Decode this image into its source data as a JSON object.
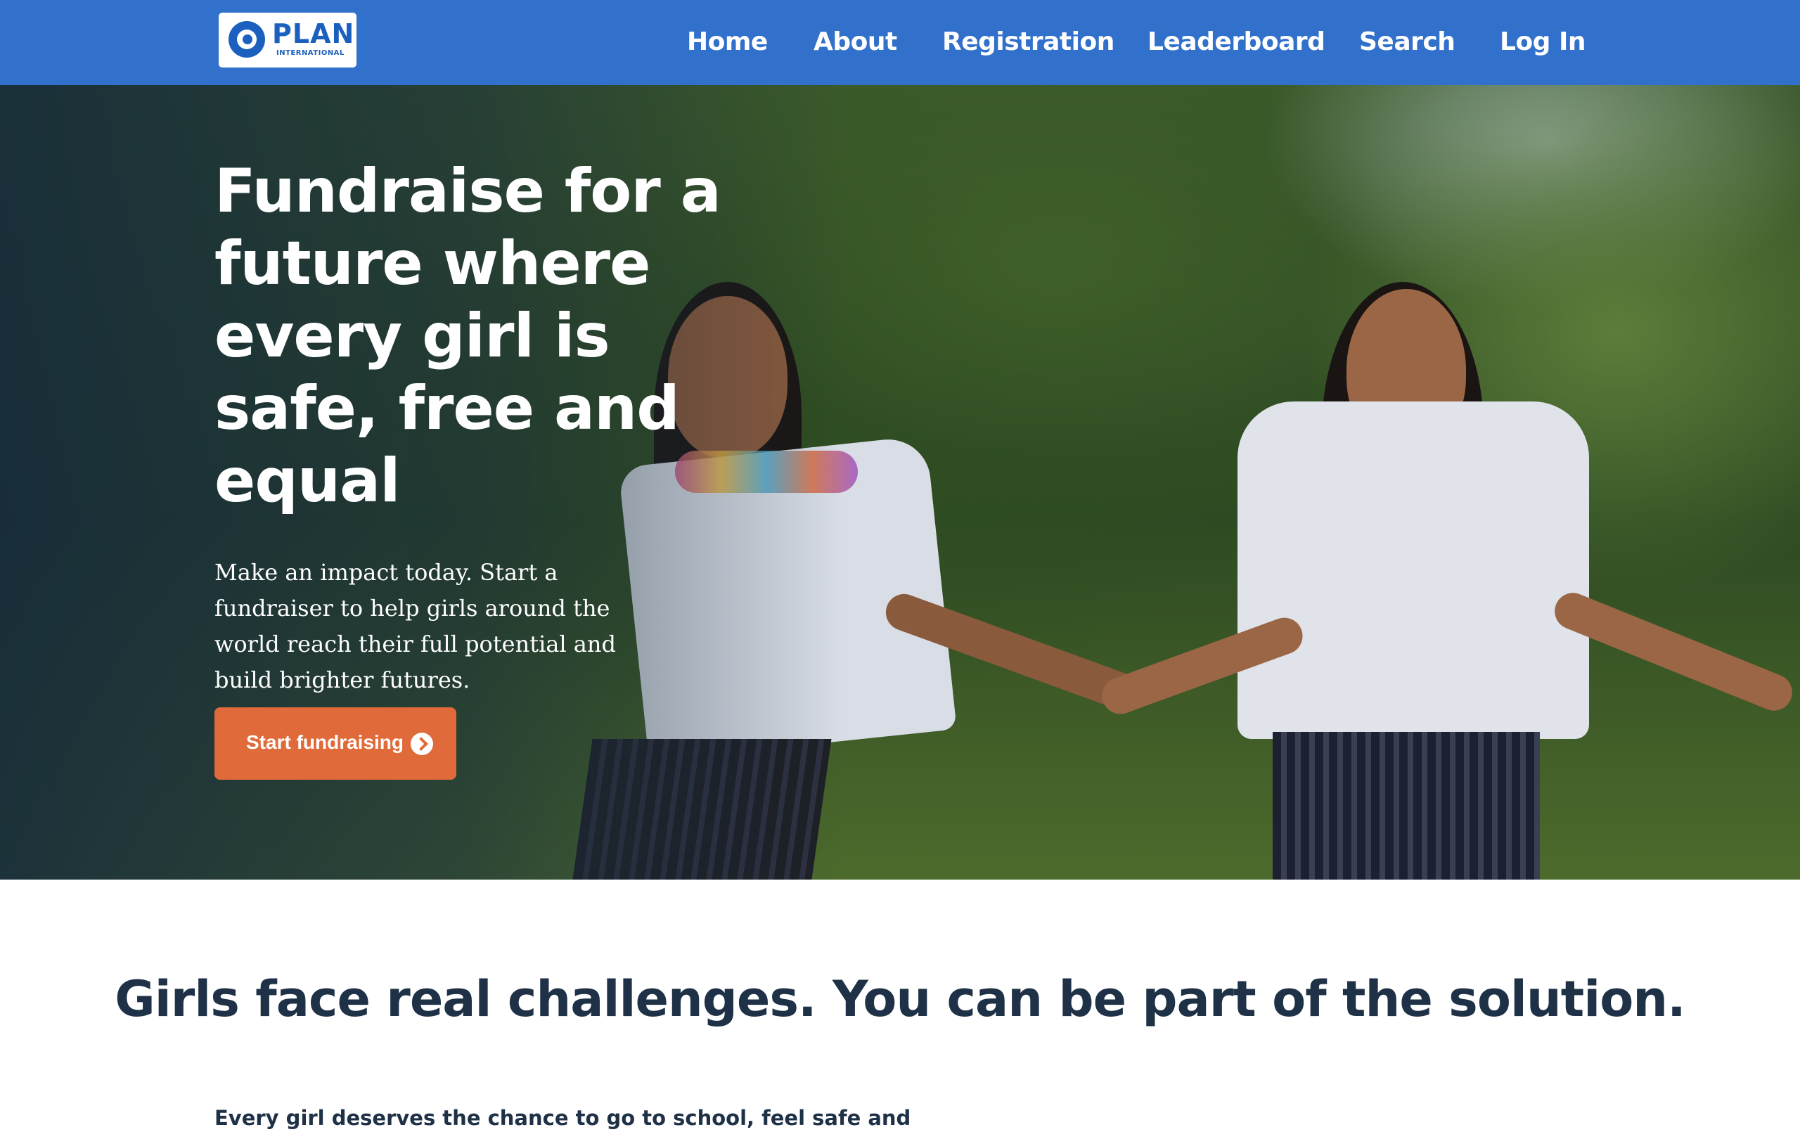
{
  "brand": {
    "name": "PLAN",
    "tagline": "INTERNATIONAL",
    "colors": {
      "nav_bg": "#3170cb",
      "accent": "#e06a3a",
      "heading": "#1f3147"
    }
  },
  "nav": {
    "items": [
      {
        "label": "Home"
      },
      {
        "label": "About"
      },
      {
        "label": "Registration"
      },
      {
        "label": "Leaderboard"
      },
      {
        "label": "Search"
      },
      {
        "label": "Log In"
      }
    ]
  },
  "hero": {
    "title": "Fundraise for a future where every girl is safe, free and equal",
    "text": "Make an impact today. Start a fundraiser to help girls around the world reach their full potential and build brighter futures.",
    "cta_label": "Start fundraising",
    "cta_icon": "chevron-right-circle-icon"
  },
  "challenges": {
    "title": "Girls face real challenges. You can be part of the solution.",
    "body": "Every girl deserves the chance to go to school, feel safe and"
  }
}
